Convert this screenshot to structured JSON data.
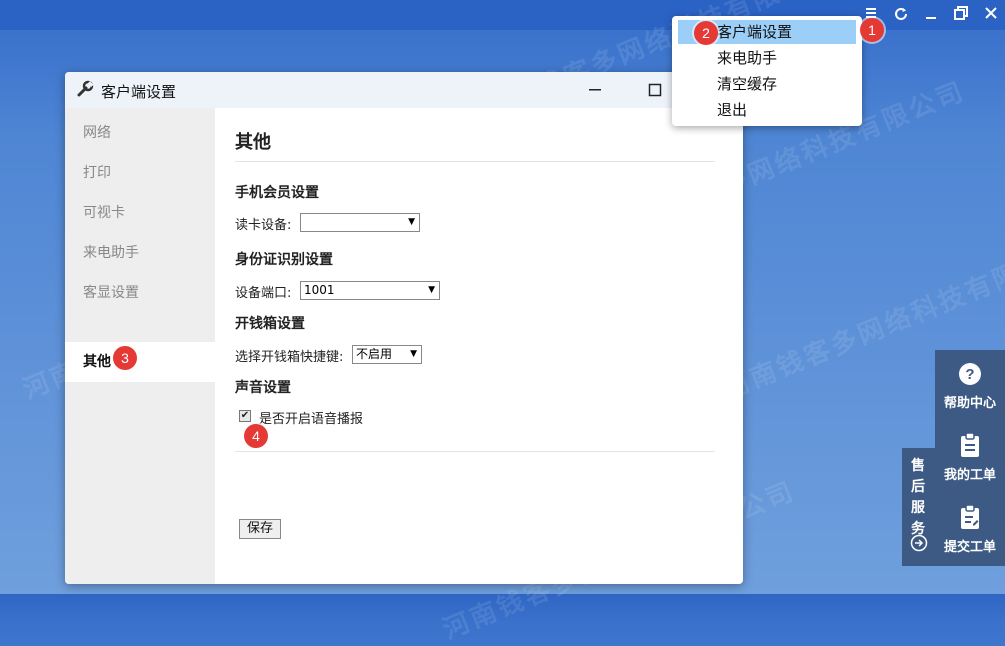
{
  "watermark": "河南钱客多网络科技有限公司",
  "menu": {
    "items": [
      {
        "label": "客户端设置",
        "active": true
      },
      {
        "label": "来电助手"
      },
      {
        "label": "清空缓存"
      },
      {
        "label": "退出"
      }
    ]
  },
  "badges": [
    "1",
    "2",
    "3",
    "4"
  ],
  "dialog": {
    "title": "客户端设置",
    "sidebar": [
      "网络",
      "打印",
      "可视卡",
      "来电助手",
      "客显设置",
      "其他"
    ],
    "content": {
      "heading": "其他",
      "member_section": "手机会员设置",
      "card_reader_label": "读卡设备:",
      "card_reader_value": "",
      "id_section": "身份证识别设置",
      "port_label": "设备端口:",
      "port_value": "1001",
      "cashbox_section": "开钱箱设置",
      "cashbox_label": "选择开钱箱快捷键:",
      "cashbox_value": "不启用",
      "sound_section": "声音设置",
      "voice_checkbox_label": "是否开启语音播报",
      "voice_checked": true,
      "save_label": "保存"
    }
  },
  "service": {
    "tab_chars": [
      "售",
      "后",
      "服",
      "务"
    ],
    "items": [
      {
        "label": "帮助中心",
        "icon": "help-icon"
      },
      {
        "label": "我的工单",
        "icon": "clipboard-icon"
      },
      {
        "label": "提交工单",
        "icon": "edit-clipboard-icon"
      }
    ]
  },
  "colors": {
    "accent": "#2b63c5",
    "badge": "#e53935",
    "menu_highlight": "#9ccff7",
    "service_panel": "#3d5a85"
  }
}
